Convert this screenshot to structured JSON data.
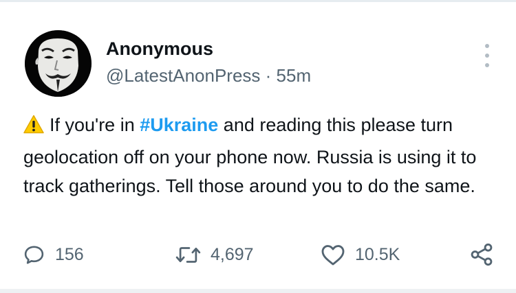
{
  "tweet": {
    "author_name": "Anonymous",
    "handle": "@LatestAnonPress",
    "separator": "·",
    "time": "55m",
    "warning_icon": "warning-emoji",
    "text_part1": "If you're in ",
    "hashtag": "#Ukraine",
    "text_part2": " and reading this please turn geolocation off on your phone now. Russia is using it to track gatherings. Tell those around you to do the same."
  },
  "actions": {
    "reply_count": "156",
    "retweet_count": "4,697",
    "like_count": "10.5K"
  },
  "icons": {
    "more": "more-vertical-icon",
    "reply": "reply-bubble-icon",
    "retweet": "retweet-icon",
    "like": "heart-icon",
    "share": "share-icon"
  },
  "colors": {
    "text": "#0f1419",
    "secondary": "#536471",
    "hashtag": "#1d9bf0",
    "warning": "#ffcc00"
  }
}
